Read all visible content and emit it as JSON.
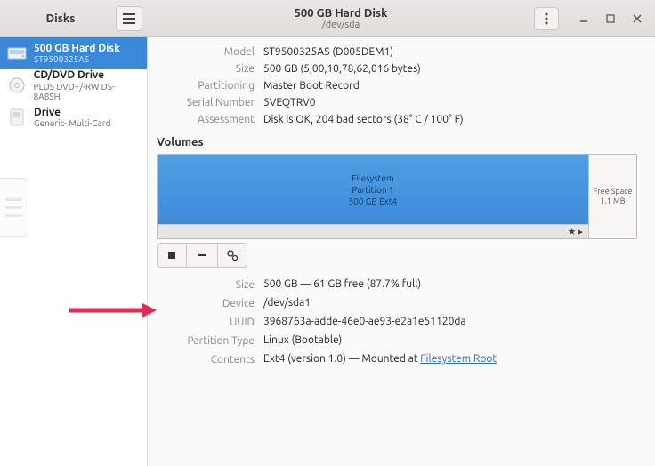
{
  "header": {
    "left_title": "Disks",
    "center_title": "500 GB Hard Disk",
    "center_subtitle": "/dev/sda"
  },
  "sidebar": {
    "items": [
      {
        "name": "500 GB Hard Disk",
        "sub": "ST9500325AS",
        "selected": true,
        "icon": "hdd"
      },
      {
        "name": "CD/DVD Drive",
        "sub": "PLDS DVD+/-RW DS-8A8SH",
        "selected": false,
        "icon": "disc"
      },
      {
        "name": "Drive",
        "sub": "Generic- Multi-Card",
        "selected": false,
        "icon": "card"
      }
    ]
  },
  "disk_info": {
    "model_k": "Model",
    "model_v": "ST9500325AS (D005DEM1)",
    "size_k": "Size",
    "size_v": "500 GB (5,00,10,78,62,016 bytes)",
    "part_k": "Partitioning",
    "part_v": "Master Boot Record",
    "serial_k": "Serial Number",
    "serial_v": "5VEQTRV0",
    "assess_k": "Assessment",
    "assess_v": "Disk is OK, 204 bad sectors (38° C / 100° F)"
  },
  "volumes": {
    "heading": "Volumes",
    "main_l1": "Filesystem",
    "main_l2": "Partition 1",
    "main_l3": "500 GB Ext4",
    "free_l1": "Free Space",
    "free_l2": "1.1 MB",
    "star": "★",
    "chev": "▸"
  },
  "partition": {
    "size_k": "Size",
    "size_v": "500 GB — 61 GB free (87.7% full)",
    "device_k": "Device",
    "device_v": "/dev/sda1",
    "uuid_k": "UUID",
    "uuid_v": "3968763a-adde-46e0-ae93-e2a1e51120da",
    "ptype_k": "Partition Type",
    "ptype_v": "Linux (Bootable)",
    "contents_k": "Contents",
    "contents_v_pre": "Ext4 (version 1.0) — Mounted at ",
    "contents_link": "Filesystem Root"
  }
}
